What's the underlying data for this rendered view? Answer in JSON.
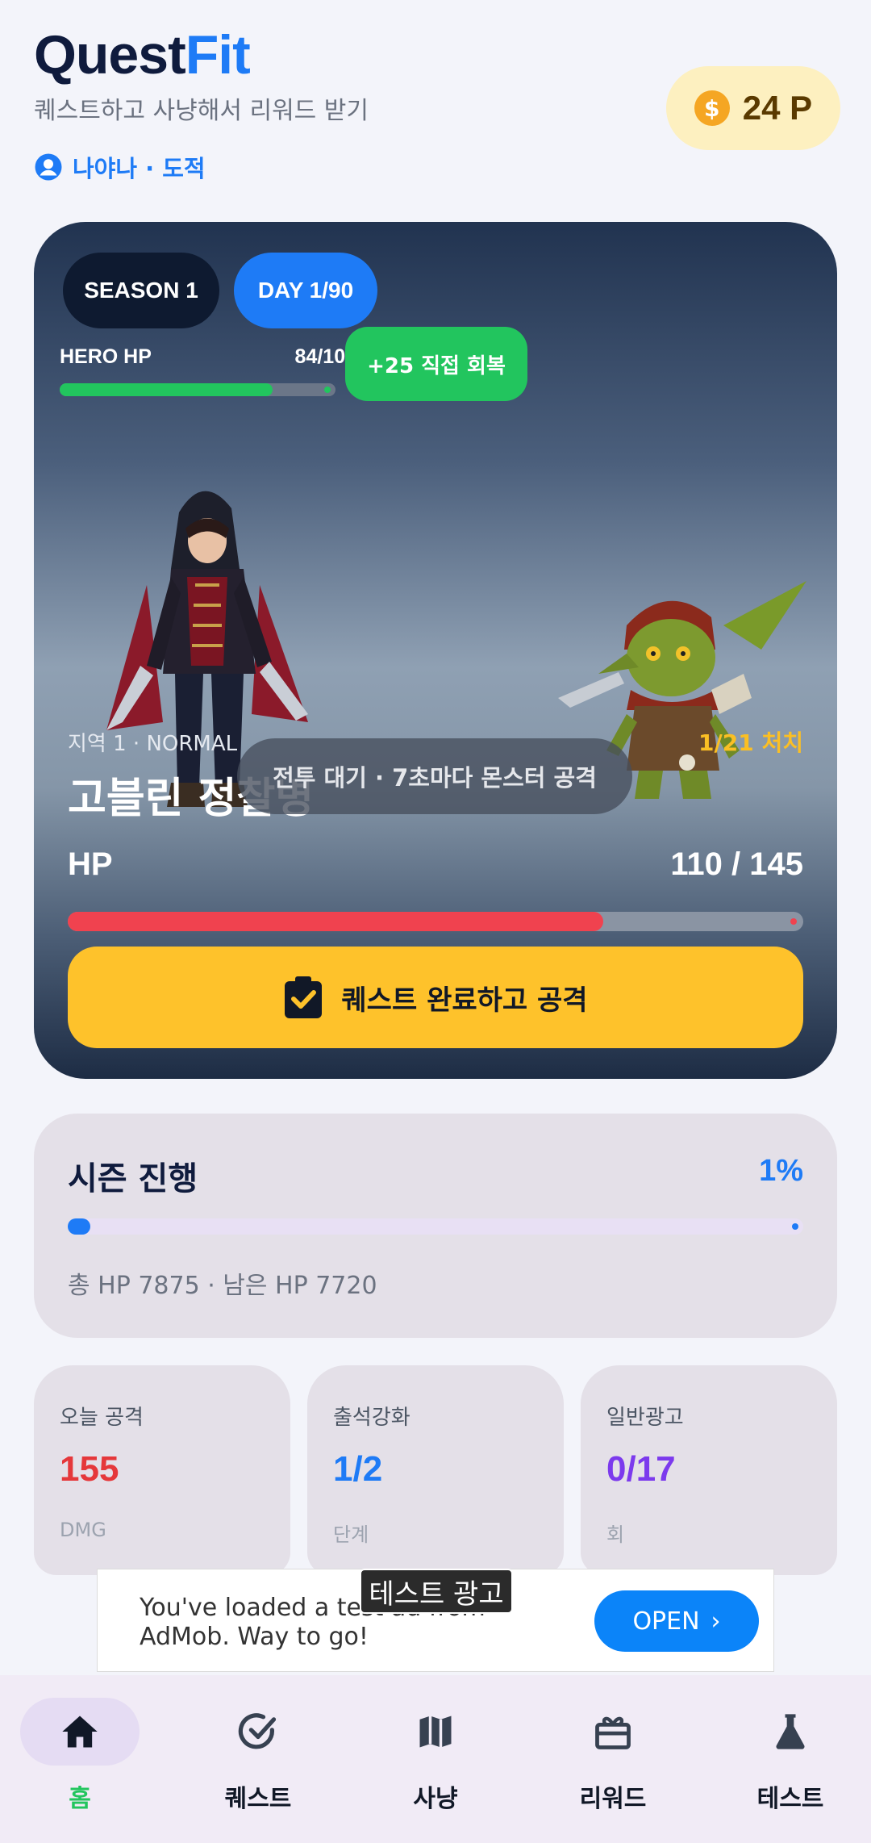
{
  "header": {
    "brand_part1": "Quest",
    "brand_part2": "Fit",
    "tagline": "퀘스트하고 사냥해서 리워드 받기",
    "user_label": "나야나 · 도적",
    "points": "24 P",
    "coin_symbol": "$"
  },
  "battle": {
    "season_chip": "SEASON 1",
    "day_chip": "DAY 1/90",
    "hero_hp_label": "HERO HP",
    "hero_hp_value": "84/100",
    "hero_hp_fraction": 0.84,
    "heal_button": "+25 직접 회복",
    "zone": "지역 1 · NORMAL",
    "kills": "1/21 처치",
    "monster_name": "고블린 정찰병",
    "wait_text": "전투 대기 · 7초마다 몬스터 공격",
    "hp_label": "HP",
    "hp_value": "110 / 145",
    "monster_hp_fraction": 0.7586,
    "attack_button": "퀘스트 완료하고 공격"
  },
  "season": {
    "title": "시즌 진행",
    "percent": "1%",
    "progress_fraction": 0.01,
    "sub": "총 HP 7875 · 남은 HP 7720"
  },
  "stats": [
    {
      "title": "오늘 공격",
      "value": "155",
      "unit": "DMG",
      "color": "#e5383b"
    },
    {
      "title": "출석강화",
      "value": "1/2",
      "unit": "단계",
      "color": "#1e7bf6"
    },
    {
      "title": "일반광고",
      "value": "0/17",
      "unit": "회",
      "color": "#7c3aed"
    }
  ],
  "ad": {
    "badge": "테스트 광고",
    "text": "You've loaded a test ad from AdMob. Way to go!",
    "open_label": "OPEN",
    "open_chevron": "›"
  },
  "nav": [
    {
      "label": "홈",
      "icon": "home-icon",
      "active": true
    },
    {
      "label": "퀘스트",
      "icon": "check-circle-icon",
      "active": false
    },
    {
      "label": "사냥",
      "icon": "map-icon",
      "active": false
    },
    {
      "label": "리워드",
      "icon": "gift-icon",
      "active": false
    },
    {
      "label": "테스트",
      "icon": "flask-icon",
      "active": false
    }
  ],
  "colors": {
    "accent": "#1e7bf6",
    "success": "#22c55e",
    "danger": "#f0424f",
    "warning": "#fec22b"
  }
}
